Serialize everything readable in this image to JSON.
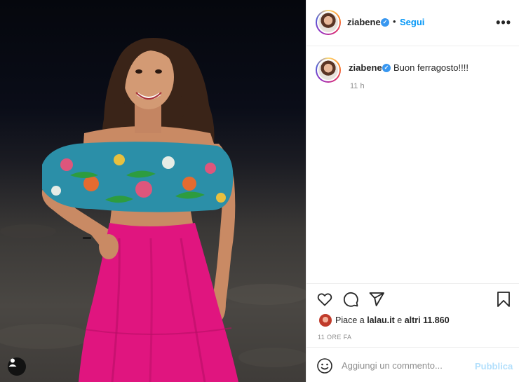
{
  "post": {
    "username": "ziabene",
    "verified": true,
    "separator": "•",
    "follow_label": "Segui",
    "more_label": "•••",
    "caption_user": "ziabene",
    "caption_text": "Buon ferragosto!!!!",
    "caption_time": "11 h",
    "likes_prefix": "Piace a",
    "likes_user": "lalau.it",
    "likes_middle": "e",
    "likes_others": "altri 11.860",
    "timestamp": "11 ORE FA",
    "comment_placeholder": "Aggiungi un commento...",
    "publish_label": "Pubblica"
  },
  "icons": {
    "like": "heart-icon",
    "comment": "comment-icon",
    "share": "paper-plane-icon",
    "save": "bookmark-icon",
    "emoji": "smiley-icon",
    "tag": "user-tag-icon",
    "verified": "verified-badge-icon"
  },
  "colors": {
    "accent": "#0095f6",
    "verified": "#3897f0",
    "publish_disabled": "#b2dffc",
    "muted": "#8e8e8e",
    "skirt": "#e0157f"
  }
}
